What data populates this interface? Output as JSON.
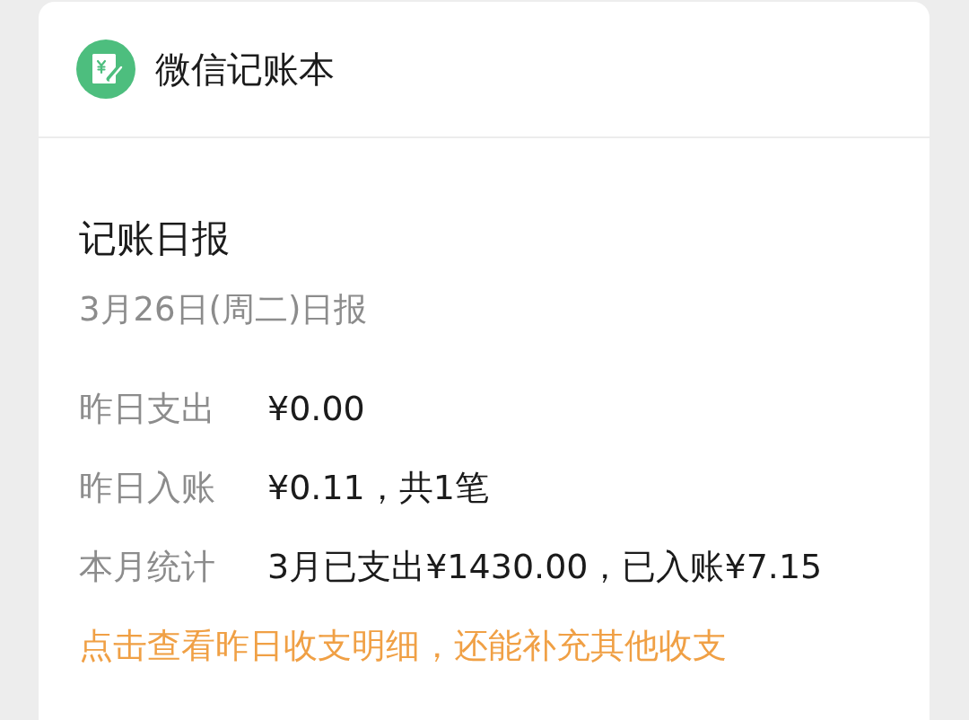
{
  "header": {
    "app_name": "微信记账本"
  },
  "report": {
    "title": "记账日报",
    "subtitle": "3月26日(周二)日报",
    "rows": [
      {
        "label": "昨日支出",
        "value": "¥0.00"
      },
      {
        "label": "昨日入账",
        "value": "¥0.11，共1笔"
      },
      {
        "label": "本月统计",
        "value": "3月已支出¥1430.00，已入账¥7.15"
      }
    ],
    "link": "点击查看昨日收支明细，还能补充其他收支"
  }
}
